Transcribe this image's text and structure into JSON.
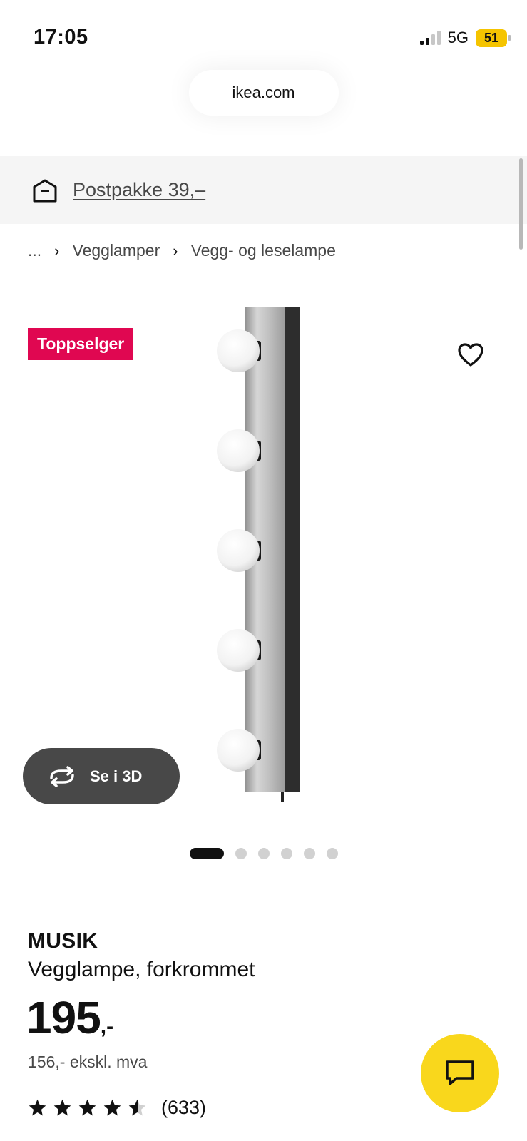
{
  "status": {
    "time": "17:05",
    "network": "5G",
    "battery": "51"
  },
  "browser": {
    "url": "ikea.com"
  },
  "shipping": {
    "label": "Postpakke 39,–",
    "icon": "package-icon"
  },
  "breadcrumb": {
    "items": [
      "...",
      "Vegglamper",
      "Vegg- og leselampe"
    ]
  },
  "product": {
    "badge": "Toppselger",
    "view3d_label": "Se i 3D",
    "name": "MUSIK",
    "description": "Vegglampe, forkrommet",
    "price_int": "195",
    "price_suffix": ",-",
    "price_ex_vat": "156,- ekskl. mva",
    "rating": 4.5,
    "review_count": "(633)",
    "gallery": {
      "total": 6,
      "active": 1
    }
  },
  "colors": {
    "badge": "#e00751",
    "fab": "#f9d71c",
    "view3d_bg": "#484848"
  }
}
